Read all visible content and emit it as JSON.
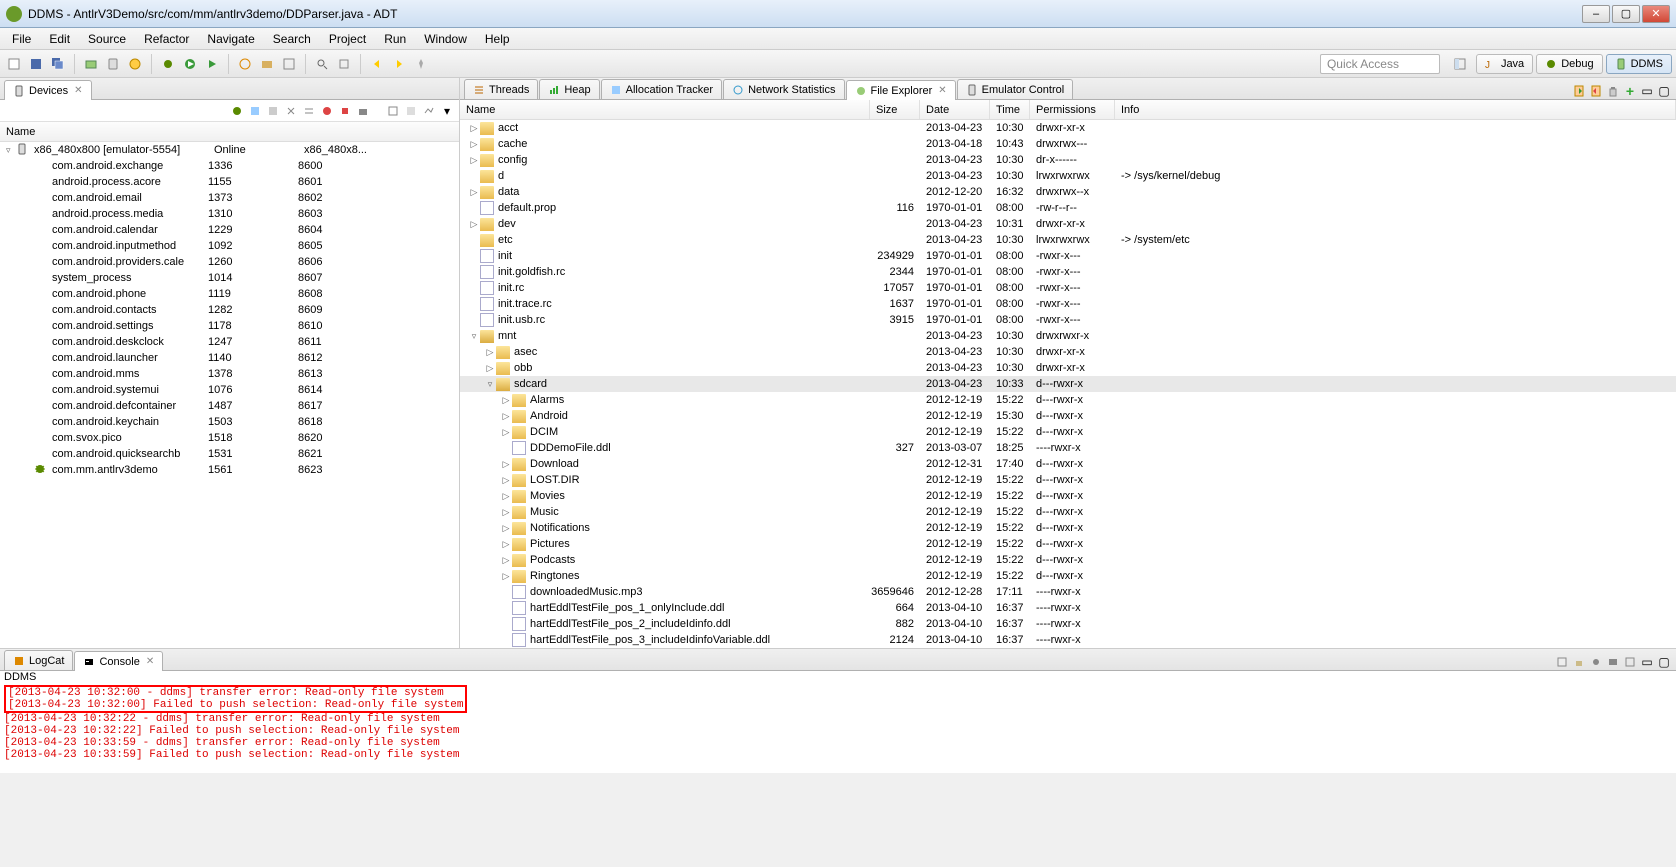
{
  "window": {
    "title": "DDMS - AntlrV3Demo/src/com/mm/antlrv3demo/DDParser.java - ADT"
  },
  "menu": [
    "File",
    "Edit",
    "Source",
    "Refactor",
    "Navigate",
    "Search",
    "Project",
    "Run",
    "Window",
    "Help"
  ],
  "quick_access": "Quick Access",
  "perspectives": [
    {
      "label": "Java",
      "icon": "java"
    },
    {
      "label": "Debug",
      "icon": "debug"
    },
    {
      "label": "DDMS",
      "icon": "ddms",
      "active": true
    }
  ],
  "devices_view": {
    "tab_label": "Devices",
    "header": "Name",
    "root": {
      "name": "x86_480x800 [emulator-5554]",
      "col2": "Online",
      "col3": "x86_480x8..."
    },
    "procs": [
      {
        "name": "com.android.exchange",
        "pid": "1336",
        "port": "8600"
      },
      {
        "name": "android.process.acore",
        "pid": "1155",
        "port": "8601"
      },
      {
        "name": "com.android.email",
        "pid": "1373",
        "port": "8602"
      },
      {
        "name": "android.process.media",
        "pid": "1310",
        "port": "8603"
      },
      {
        "name": "com.android.calendar",
        "pid": "1229",
        "port": "8604"
      },
      {
        "name": "com.android.inputmethod",
        "pid": "1092",
        "port": "8605"
      },
      {
        "name": "com.android.providers.cale",
        "pid": "1260",
        "port": "8606"
      },
      {
        "name": "system_process",
        "pid": "1014",
        "port": "8607"
      },
      {
        "name": "com.android.phone",
        "pid": "1119",
        "port": "8608"
      },
      {
        "name": "com.android.contacts",
        "pid": "1282",
        "port": "8609"
      },
      {
        "name": "com.android.settings",
        "pid": "1178",
        "port": "8610"
      },
      {
        "name": "com.android.deskclock",
        "pid": "1247",
        "port": "8611"
      },
      {
        "name": "com.android.launcher",
        "pid": "1140",
        "port": "8612"
      },
      {
        "name": "com.android.mms",
        "pid": "1378",
        "port": "8613"
      },
      {
        "name": "com.android.systemui",
        "pid": "1076",
        "port": "8614"
      },
      {
        "name": "com.android.defcontainer",
        "pid": "1487",
        "port": "8617"
      },
      {
        "name": "com.android.keychain",
        "pid": "1503",
        "port": "8618"
      },
      {
        "name": "com.svox.pico",
        "pid": "1518",
        "port": "8620"
      },
      {
        "name": "com.android.quicksearchb",
        "pid": "1531",
        "port": "8621"
      },
      {
        "name": "com.mm.antlrv3demo",
        "pid": "1561",
        "port": "8623",
        "debug": true
      }
    ]
  },
  "right_tabs": [
    {
      "label": "Threads",
      "icon": "threads"
    },
    {
      "label": "Heap",
      "icon": "heap"
    },
    {
      "label": "Allocation Tracker",
      "icon": "alloc"
    },
    {
      "label": "Network Statistics",
      "icon": "net"
    },
    {
      "label": "File Explorer",
      "icon": "file",
      "active": true
    },
    {
      "label": "Emulator Control",
      "icon": "emu"
    }
  ],
  "file_explorer": {
    "headers": {
      "name": "Name",
      "size": "Size",
      "date": "Date",
      "time": "Time",
      "perm": "Permissions",
      "info": "Info"
    },
    "rows": [
      {
        "indent": 0,
        "tw": "▷",
        "type": "folder",
        "name": "acct",
        "date": "2013-04-23",
        "time": "10:30",
        "perm": "drwxr-xr-x"
      },
      {
        "indent": 0,
        "tw": "▷",
        "type": "folder",
        "name": "cache",
        "date": "2013-04-18",
        "time": "10:43",
        "perm": "drwxrwx---"
      },
      {
        "indent": 0,
        "tw": "▷",
        "type": "folder",
        "name": "config",
        "date": "2013-04-23",
        "time": "10:30",
        "perm": "dr-x------"
      },
      {
        "indent": 0,
        "tw": "",
        "type": "folder",
        "name": "d",
        "date": "2013-04-23",
        "time": "10:30",
        "perm": "lrwxrwxrwx",
        "info": "-> /sys/kernel/debug"
      },
      {
        "indent": 0,
        "tw": "▷",
        "type": "folder",
        "name": "data",
        "date": "2012-12-20",
        "time": "16:32",
        "perm": "drwxrwx--x"
      },
      {
        "indent": 0,
        "tw": "",
        "type": "file",
        "name": "default.prop",
        "size": "116",
        "date": "1970-01-01",
        "time": "08:00",
        "perm": "-rw-r--r--"
      },
      {
        "indent": 0,
        "tw": "▷",
        "type": "folder",
        "name": "dev",
        "date": "2013-04-23",
        "time": "10:31",
        "perm": "drwxr-xr-x"
      },
      {
        "indent": 0,
        "tw": "",
        "type": "folder",
        "name": "etc",
        "date": "2013-04-23",
        "time": "10:30",
        "perm": "lrwxrwxrwx",
        "info": "-> /system/etc"
      },
      {
        "indent": 0,
        "tw": "",
        "type": "file",
        "name": "init",
        "size": "234929",
        "date": "1970-01-01",
        "time": "08:00",
        "perm": "-rwxr-x---"
      },
      {
        "indent": 0,
        "tw": "",
        "type": "file",
        "name": "init.goldfish.rc",
        "size": "2344",
        "date": "1970-01-01",
        "time": "08:00",
        "perm": "-rwxr-x---"
      },
      {
        "indent": 0,
        "tw": "",
        "type": "file",
        "name": "init.rc",
        "size": "17057",
        "date": "1970-01-01",
        "time": "08:00",
        "perm": "-rwxr-x---"
      },
      {
        "indent": 0,
        "tw": "",
        "type": "file",
        "name": "init.trace.rc",
        "size": "1637",
        "date": "1970-01-01",
        "time": "08:00",
        "perm": "-rwxr-x---"
      },
      {
        "indent": 0,
        "tw": "",
        "type": "file",
        "name": "init.usb.rc",
        "size": "3915",
        "date": "1970-01-01",
        "time": "08:00",
        "perm": "-rwxr-x---"
      },
      {
        "indent": 0,
        "tw": "▿",
        "type": "folder-open",
        "name": "mnt",
        "date": "2013-04-23",
        "time": "10:30",
        "perm": "drwxrwxr-x"
      },
      {
        "indent": 1,
        "tw": "▷",
        "type": "folder",
        "name": "asec",
        "date": "2013-04-23",
        "time": "10:30",
        "perm": "drwxr-xr-x"
      },
      {
        "indent": 1,
        "tw": "▷",
        "type": "folder",
        "name": "obb",
        "date": "2013-04-23",
        "time": "10:30",
        "perm": "drwxr-xr-x"
      },
      {
        "indent": 1,
        "tw": "▿",
        "type": "folder-open",
        "name": "sdcard",
        "date": "2013-04-23",
        "time": "10:33",
        "perm": "d---rwxr-x",
        "selected": true
      },
      {
        "indent": 2,
        "tw": "▷",
        "type": "folder",
        "name": "Alarms",
        "date": "2012-12-19",
        "time": "15:22",
        "perm": "d---rwxr-x"
      },
      {
        "indent": 2,
        "tw": "▷",
        "type": "folder",
        "name": "Android",
        "date": "2012-12-19",
        "time": "15:30",
        "perm": "d---rwxr-x"
      },
      {
        "indent": 2,
        "tw": "▷",
        "type": "folder",
        "name": "DCIM",
        "date": "2012-12-19",
        "time": "15:22",
        "perm": "d---rwxr-x"
      },
      {
        "indent": 2,
        "tw": "",
        "type": "file",
        "name": "DDDemoFile.ddl",
        "size": "327",
        "date": "2013-03-07",
        "time": "18:25",
        "perm": "----rwxr-x"
      },
      {
        "indent": 2,
        "tw": "▷",
        "type": "folder",
        "name": "Download",
        "date": "2012-12-31",
        "time": "17:40",
        "perm": "d---rwxr-x"
      },
      {
        "indent": 2,
        "tw": "▷",
        "type": "folder",
        "name": "LOST.DIR",
        "date": "2012-12-19",
        "time": "15:22",
        "perm": "d---rwxr-x"
      },
      {
        "indent": 2,
        "tw": "▷",
        "type": "folder",
        "name": "Movies",
        "date": "2012-12-19",
        "time": "15:22",
        "perm": "d---rwxr-x"
      },
      {
        "indent": 2,
        "tw": "▷",
        "type": "folder",
        "name": "Music",
        "date": "2012-12-19",
        "time": "15:22",
        "perm": "d---rwxr-x"
      },
      {
        "indent": 2,
        "tw": "▷",
        "type": "folder",
        "name": "Notifications",
        "date": "2012-12-19",
        "time": "15:22",
        "perm": "d---rwxr-x"
      },
      {
        "indent": 2,
        "tw": "▷",
        "type": "folder",
        "name": "Pictures",
        "date": "2012-12-19",
        "time": "15:22",
        "perm": "d---rwxr-x"
      },
      {
        "indent": 2,
        "tw": "▷",
        "type": "folder",
        "name": "Podcasts",
        "date": "2012-12-19",
        "time": "15:22",
        "perm": "d---rwxr-x"
      },
      {
        "indent": 2,
        "tw": "▷",
        "type": "folder",
        "name": "Ringtones",
        "date": "2012-12-19",
        "time": "15:22",
        "perm": "d---rwxr-x"
      },
      {
        "indent": 2,
        "tw": "",
        "type": "file",
        "name": "downloadedMusic.mp3",
        "size": "3659646",
        "date": "2012-12-28",
        "time": "17:11",
        "perm": "----rwxr-x"
      },
      {
        "indent": 2,
        "tw": "",
        "type": "file",
        "name": "hartEddlTestFile_pos_1_onlyInclude.ddl",
        "size": "664",
        "date": "2013-04-10",
        "time": "16:37",
        "perm": "----rwxr-x"
      },
      {
        "indent": 2,
        "tw": "",
        "type": "file",
        "name": "hartEddlTestFile_pos_2_includeIdinfo.ddl",
        "size": "882",
        "date": "2013-04-10",
        "time": "16:37",
        "perm": "----rwxr-x"
      },
      {
        "indent": 2,
        "tw": "",
        "type": "file",
        "name": "hartEddlTestFile_pos_3_includeIdinfoVariable.ddl",
        "size": "2124",
        "date": "2013-04-10",
        "time": "16:37",
        "perm": "----rwxr-x"
      }
    ]
  },
  "bottom_tabs": [
    {
      "label": "LogCat",
      "icon": "logcat"
    },
    {
      "label": "Console",
      "icon": "console",
      "active": true
    }
  ],
  "console": {
    "label": "DDMS",
    "highlighted": [
      "[2013-04-23 10:32:00 - ddms] transfer error: Read-only file system",
      "[2013-04-23 10:32:00] Failed to push selection: Read-only file system"
    ],
    "lines": [
      "[2013-04-23 10:32:22 - ddms] transfer error: Read-only file system",
      "[2013-04-23 10:32:22] Failed to push selection: Read-only file system",
      "[2013-04-23 10:33:59 - ddms] transfer error: Read-only file system",
      "[2013-04-23 10:33:59] Failed to push selection: Read-only file system"
    ]
  }
}
